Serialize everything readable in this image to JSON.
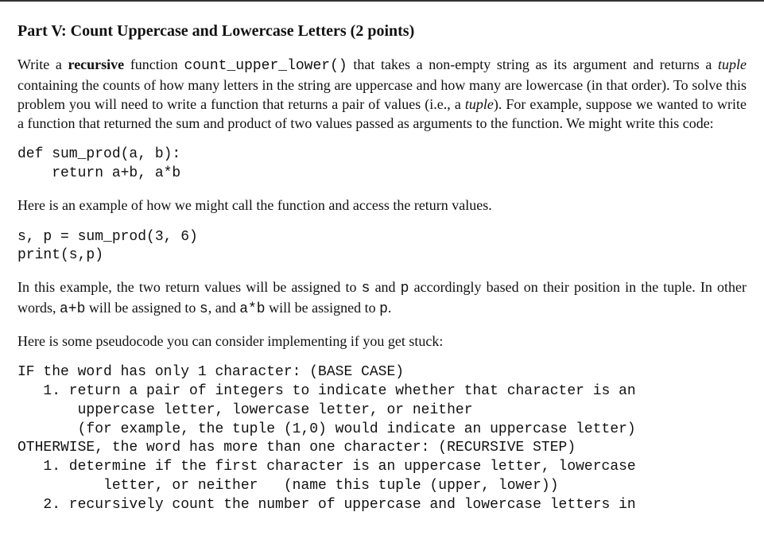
{
  "heading": "Part V: Count Uppercase and Lowercase Letters (2 points)",
  "p1a": "Write a ",
  "p1b": "recursive",
  "p1c": " function ",
  "p1d": "count_upper_lower()",
  "p1e": " that takes a non-empty string as its argument and returns a ",
  "p1f": "tuple",
  "p1g": " containing the counts of how many letters in the string are uppercase and how many are lowercase (in that order). To solve this problem you will need to write a function that returns a pair of values (i.e., a ",
  "p1h": "tuple",
  "p1i": "). For example, suppose we wanted to write a function that returned the sum and product of two values passed as arguments to the function. We might write this code:",
  "code1": "def sum_prod(a, b):\n    return a+b, a*b",
  "p2": "Here is an example of how we might call the function and access the return values.",
  "code2": "s, p = sum_prod(3, 6)\nprint(s,p)",
  "p3a": "In this example, the two return values will be assigned to ",
  "p3b": "s",
  "p3c": " and ",
  "p3d": "p",
  "p3e": " accordingly based on their position in the tuple. In other words, ",
  "p3f": "a+b",
  "p3g": " will be assigned to ",
  "p3h": "s",
  "p3i": ", and ",
  "p3j": "a*b",
  "p3k": " will be assigned to ",
  "p3l": "p",
  "p3m": ".",
  "p4": "Here is some pseudocode you can consider implementing if you get stuck:",
  "pseudo": "IF the word has only 1 character: (BASE CASE)\n   1. return a pair of integers to indicate whether that character is an\n       uppercase letter, lowercase letter, or neither\n       (for example, the tuple (1,0) would indicate an uppercase letter)\nOTHERWISE, the word has more than one character: (RECURSIVE STEP)\n   1. determine if the first character is an uppercase letter, lowercase\n          letter, or neither   (name this tuple (upper, lower))\n   2. recursively count the number of uppercase and lowercase letters in"
}
